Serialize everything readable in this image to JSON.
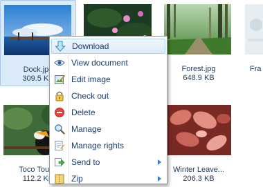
{
  "tiles": [
    {
      "name": "Dock.jpg",
      "size": "309.5 KB"
    },
    {
      "name": "",
      "size": ""
    },
    {
      "name": "Forest.jpg",
      "size": "648.9 KB"
    },
    {
      "name": "Fra",
      "size": ""
    },
    {
      "name": "Toco Touca",
      "size": "112.2 KB"
    },
    {
      "name": "",
      "size": ""
    },
    {
      "name": "Winter Leave...",
      "size": "206.3 KB"
    }
  ],
  "context_menu": {
    "items": [
      {
        "label": "Download",
        "icon": "download-arrow-icon"
      },
      {
        "label": "View document",
        "icon": "eye-icon"
      },
      {
        "label": "Edit image",
        "icon": "edit-image-icon"
      },
      {
        "label": "Check out",
        "icon": "lock-icon"
      },
      {
        "label": "Delete",
        "icon": "delete-icon"
      },
      {
        "label": "Manage",
        "icon": "magnifier-icon"
      },
      {
        "label": "Manage rights",
        "icon": "rights-icon"
      },
      {
        "label": "Send to",
        "icon": "send-arrow-icon"
      },
      {
        "label": "Zip",
        "icon": "zip-icon"
      }
    ]
  },
  "colors": {
    "menu_text": "#1a3d6e",
    "tile_text": "#1e3a5f",
    "selection": "#dbeaf9",
    "hover": "#dcebfa"
  }
}
